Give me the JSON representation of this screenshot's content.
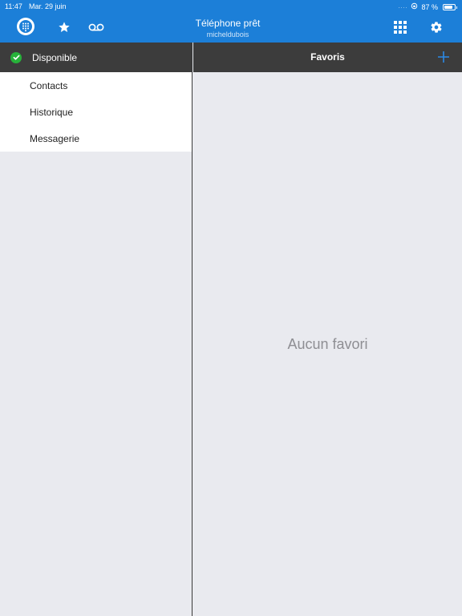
{
  "status": {
    "time": "11:47",
    "date": "Mar. 29 juin",
    "battery": "87 %",
    "battery_level": 0.87
  },
  "header": {
    "title": "Téléphone prêt",
    "subtitle": "micheldubois"
  },
  "sidebar": {
    "presence_label": "Disponible",
    "items": [
      {
        "label": "Contacts"
      },
      {
        "label": "Historique"
      },
      {
        "label": "Messagerie"
      }
    ]
  },
  "main": {
    "title": "Favoris",
    "empty_message": "Aucun favori"
  },
  "colors": {
    "accent": "#1c7fd8",
    "dark_bar": "#3c3c3c",
    "presence_green": "#27b23a",
    "background": "#e9eaef"
  }
}
